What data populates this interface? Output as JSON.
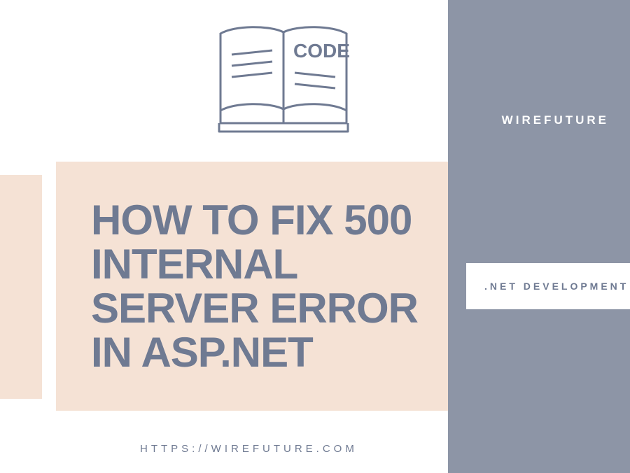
{
  "brand": "WIREFUTURE",
  "title": "HOW TO FIX 500 INTERNAL SERVER ERROR IN ASP.NET",
  "category": ".NET DEVELOPMENT",
  "url": "HTTPS://WIREFUTURE.COM",
  "book_text": "CODE",
  "colors": {
    "gray": "#8d95a6",
    "pink": "#f5e2d5",
    "text": "#6f7a92"
  }
}
